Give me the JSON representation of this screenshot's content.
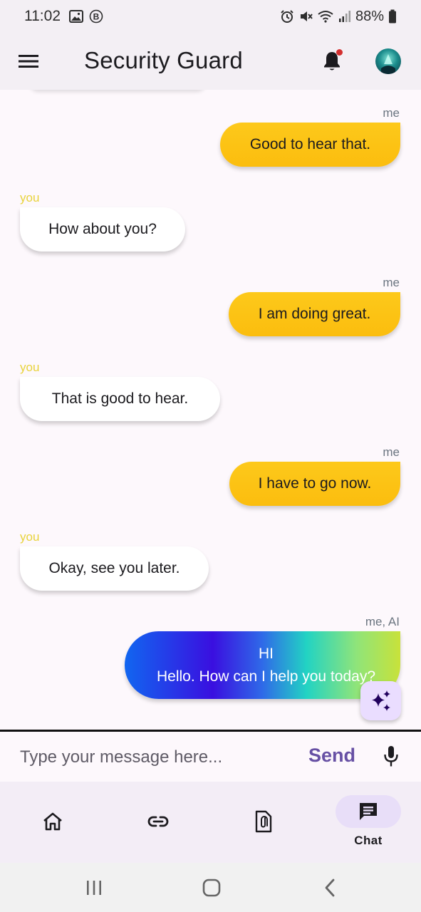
{
  "status_bar": {
    "time": "11:02",
    "battery": "88%"
  },
  "app_bar": {
    "title": "Security Guard"
  },
  "messages": [
    {
      "sender": "me",
      "label": "me",
      "text": "Good to hear that."
    },
    {
      "sender": "you",
      "label": "you",
      "text": "How about you?"
    },
    {
      "sender": "me",
      "label": "me",
      "text": "I am doing great."
    },
    {
      "sender": "you",
      "label": "you",
      "text": "That is good to hear."
    },
    {
      "sender": "me",
      "label": "me",
      "text": "I have to go now."
    },
    {
      "sender": "you",
      "label": "you",
      "text": "Okay, see you later."
    }
  ],
  "ai_message": {
    "label": "me, AI",
    "line1": "HI",
    "line2": "Hello. How can I help you today?"
  },
  "composer": {
    "placeholder": "Type your message here...",
    "send_label": "Send"
  },
  "bottom_nav": {
    "items": [
      {
        "icon": "home-icon",
        "label": ""
      },
      {
        "icon": "link-icon",
        "label": ""
      },
      {
        "icon": "attachment-file-icon",
        "label": ""
      },
      {
        "icon": "chat-icon",
        "label": "Chat",
        "active": true
      }
    ]
  },
  "colors": {
    "me_bubble": "#fbbd0e",
    "you_label": "#e8d33a",
    "accent": "#6750a4",
    "active_pill": "#e8def8"
  }
}
